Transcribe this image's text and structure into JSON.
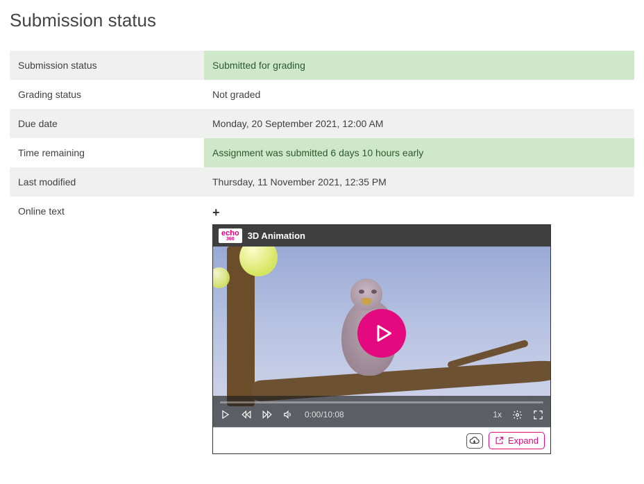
{
  "page": {
    "title": "Submission status"
  },
  "rows": {
    "submission_status": {
      "label": "Submission status",
      "value": "Submitted for grading"
    },
    "grading_status": {
      "label": "Grading status",
      "value": "Not graded"
    },
    "due_date": {
      "label": "Due date",
      "value": "Monday, 20 September 2021, 12:00 AM"
    },
    "time_remaining": {
      "label": "Time remaining",
      "value": "Assignment was submitted 6 days 10 hours early"
    },
    "last_modified": {
      "label": "Last modified",
      "value": "Thursday, 11 November 2021, 12:35 PM"
    },
    "online_text": {
      "label": "Online text"
    }
  },
  "video": {
    "provider": "echo",
    "provider_sub": "360",
    "title": "3D Animation",
    "current_time": "0:00",
    "duration": "10:08",
    "timecode": "0:00/10:08",
    "speed": "1x"
  },
  "footer": {
    "expand_label": "Expand"
  },
  "icons": {
    "plus": "+"
  }
}
